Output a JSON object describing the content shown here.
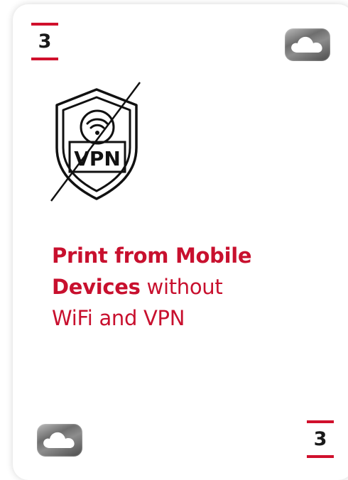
{
  "card": {
    "number": "3",
    "headline": {
      "bold": "Print from Mobile Devices",
      "regular_inline": "without",
      "regular_line": "WiFi and VPN"
    },
    "icon": "vpn-shield-crossed-out-icon",
    "badge_icon": "cloud-icon"
  },
  "colors": {
    "accent": "#c8102e",
    "number": "#1a1a1a",
    "icon_stroke": "#111111",
    "badge": "#7a7a7a"
  }
}
